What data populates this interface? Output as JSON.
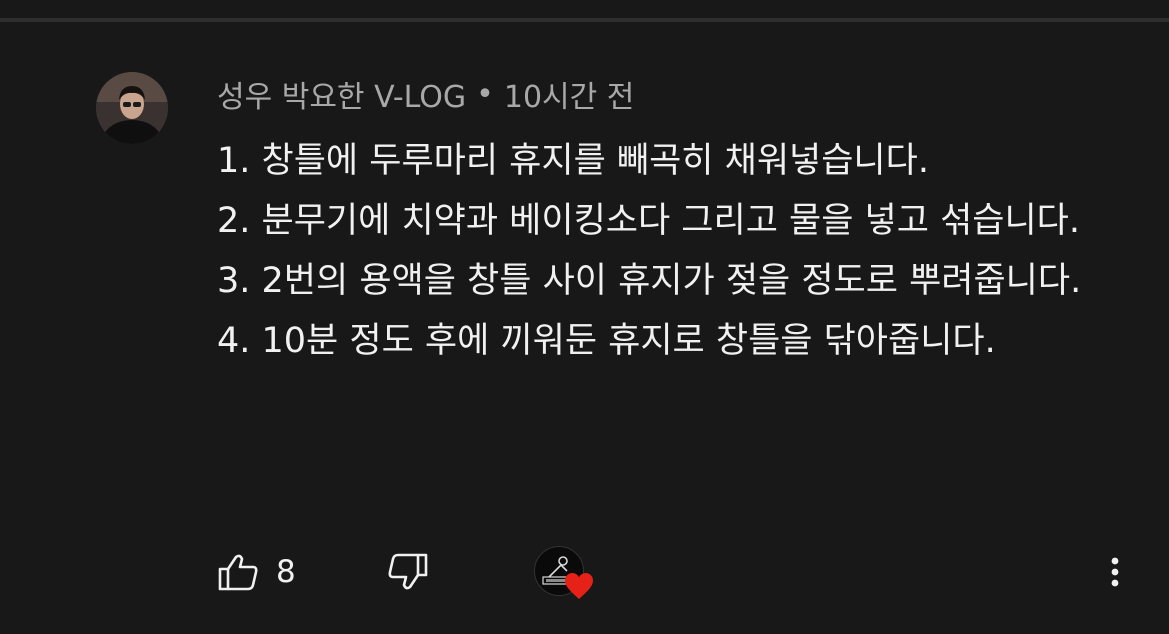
{
  "comment": {
    "author": "성우 박요한 V-LOG",
    "separator": "•",
    "time": "10시간 전",
    "lines": [
      "1. 창틀에 두루마리 휴지를 빼곡히 채워넣습니다.",
      "2. 분무기에 치약과 베이킹소다 그리고 물을 넣고 섞습니다.",
      "3. 2번의 용액을 창틀 사이 휴지가 젖을 정도로 뿌려줍니다.",
      "4. 10분 정도 후에 끼워둔 휴지로 창틀을 닦아줍니다."
    ]
  },
  "actions": {
    "like_count": "8",
    "like_icon": "thumbs-up-icon",
    "dislike_icon": "thumbs-down-icon",
    "creator_heart_icon": "heart-icon",
    "more_icon": "more-vertical-icon"
  },
  "colors": {
    "background": "#181818",
    "text": "#f1f1f1",
    "meta": "#a8a8a8",
    "heart": "#e62117"
  }
}
